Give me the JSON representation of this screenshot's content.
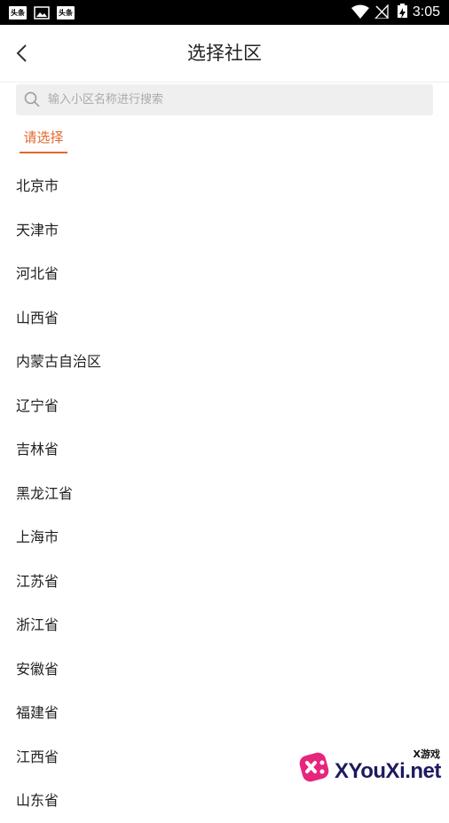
{
  "status_bar": {
    "notification_1": "头条",
    "notification_3": "头条",
    "time": "3:05"
  },
  "header": {
    "title": "选择社区"
  },
  "search": {
    "placeholder": "输入小区名称进行搜索",
    "value": ""
  },
  "tabs": [
    {
      "label": "请选择",
      "active": true
    }
  ],
  "regions": [
    "北京市",
    "天津市",
    "河北省",
    "山西省",
    "内蒙古自治区",
    "辽宁省",
    "吉林省",
    "黑龙江省",
    "上海市",
    "江苏省",
    "浙江省",
    "安徽省",
    "福建省",
    "江西省",
    "山东省"
  ],
  "watermark": {
    "text": "XYouXi.net",
    "sub": "X游戏"
  },
  "colors": {
    "accent": "#e2682b",
    "status_bar": "#000000",
    "search_bg": "#efefef"
  }
}
